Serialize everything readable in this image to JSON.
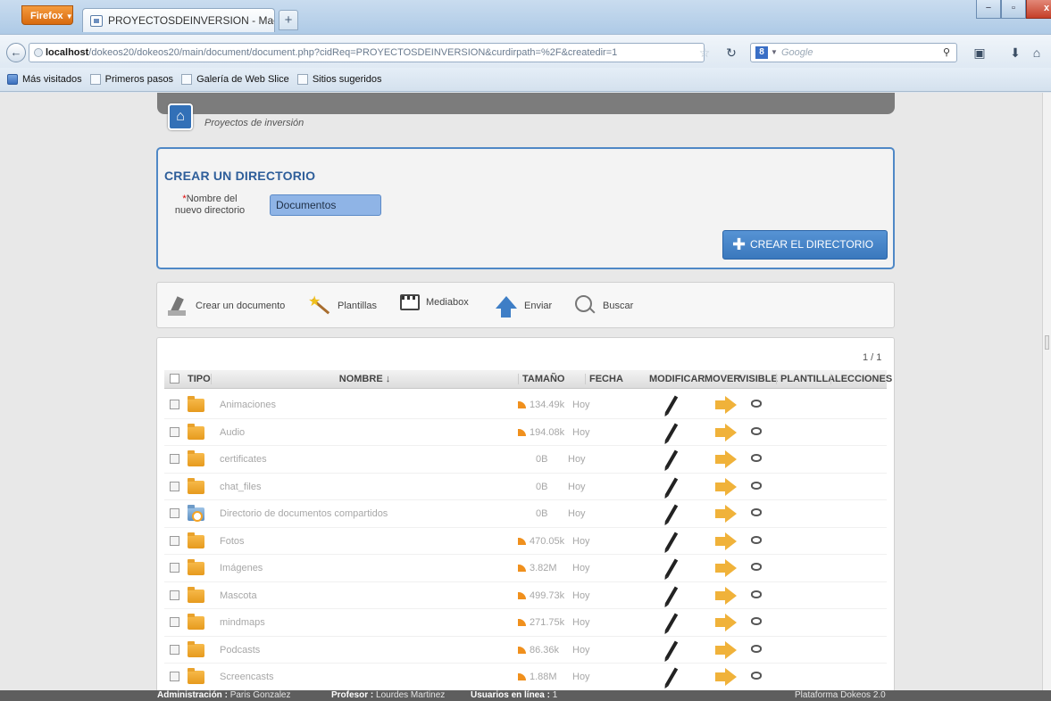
{
  "browser": {
    "menu_label": "Firefox",
    "tab_title": "PROYECTOSDEINVERSION - Maestría en ...",
    "new_tab": "+",
    "url_host": "localhost",
    "url_rest": "/dokeos20/dokeos20/main/document/document.php?cidReq=PROYECTOSDEINVERSION&curdirpath=%2F&createdir=1",
    "search_placeholder": "Google",
    "search_engine": "8",
    "bookmarks": [
      "Más visitados",
      "Primeros pasos",
      "Galería de Web Slice",
      "Sitios sugeridos"
    ],
    "window_buttons": {
      "minimize": "−",
      "maximize": "▫",
      "close": "x"
    }
  },
  "page": {
    "breadcrumb": "Proyectos de inversión",
    "create_panel": {
      "title": "CREAR UN DIRECTORIO",
      "required_mark": "*",
      "field_label_line1": "Nombre del",
      "field_label_line2": "nuevo directorio",
      "input_value": "Documentos",
      "submit_label": "CREAR EL DIRECTORIO"
    },
    "toolbar": {
      "create_doc": "Crear un documento",
      "templates": "Plantillas",
      "mediabox": "Mediabox",
      "upload": "Enviar",
      "search": "Buscar"
    },
    "list": {
      "pager": "1 / 1",
      "headers": {
        "type": "TIPO",
        "name": "NOMBRE ↓",
        "size": "TAMAÑO",
        "date": "FECHA",
        "modify": "MODIFICAR",
        "move": "MOVER",
        "visible": "VISIBLE",
        "template": "PLANTILLA",
        "lessons": "LECCIONES"
      },
      "rows": [
        {
          "name": "Animaciones",
          "size": "134.49k",
          "date": "Hoy",
          "icon": "folder-icon",
          "arrow": true
        },
        {
          "name": "Audio",
          "size": "194.08k",
          "date": "Hoy",
          "icon": "folder-icon",
          "arrow": true
        },
        {
          "name": "certificates",
          "size": "0B",
          "date": "Hoy",
          "icon": "folder-icon",
          "arrow": false
        },
        {
          "name": "chat_files",
          "size": "0B",
          "date": "Hoy",
          "icon": "folder-icon",
          "arrow": false
        },
        {
          "name": "Directorio de documentos compartidos",
          "size": "0B",
          "date": "Hoy",
          "icon": "shared-folder-icon",
          "arrow": false
        },
        {
          "name": "Fotos",
          "size": "470.05k",
          "date": "Hoy",
          "icon": "folder-icon",
          "arrow": true
        },
        {
          "name": "Imágenes",
          "size": "3.82M",
          "date": "Hoy",
          "icon": "folder-icon",
          "arrow": true
        },
        {
          "name": "Mascota",
          "size": "499.73k",
          "date": "Hoy",
          "icon": "folder-icon",
          "arrow": true
        },
        {
          "name": "mindmaps",
          "size": "271.75k",
          "date": "Hoy",
          "icon": "folder-icon",
          "arrow": true
        },
        {
          "name": "Podcasts",
          "size": "86.36k",
          "date": "Hoy",
          "icon": "folder-icon",
          "arrow": true
        },
        {
          "name": "Screencasts",
          "size": "1.88M",
          "date": "Hoy",
          "icon": "folder-icon",
          "arrow": true
        }
      ]
    },
    "footer": {
      "admin_label": "Administración :",
      "admin_name": "Paris Gonzalez",
      "teacher_label": "Profesor :",
      "teacher_name": "Lourdes Martinez",
      "online_label": "Usuarios en línea :",
      "online_count": "1",
      "platform": "Plataforma Dokeos 2.0"
    }
  },
  "colors": {
    "accent": "#3a78bd",
    "folder": "#e69a1d",
    "page_bg": "#e8e8e8"
  }
}
